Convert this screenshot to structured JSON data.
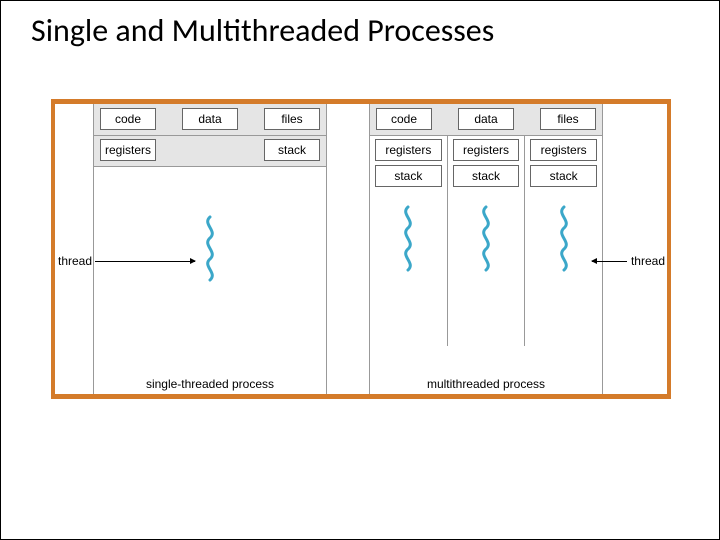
{
  "title": "Single and Multithreaded Processes",
  "shared": {
    "code": "code",
    "data": "data",
    "files": "files"
  },
  "per_thread": {
    "registers": "registers",
    "stack": "stack"
  },
  "labels": {
    "thread_left": "thread",
    "thread_right": "thread",
    "caption_single": "single-threaded process",
    "caption_multi": "multithreaded process"
  }
}
